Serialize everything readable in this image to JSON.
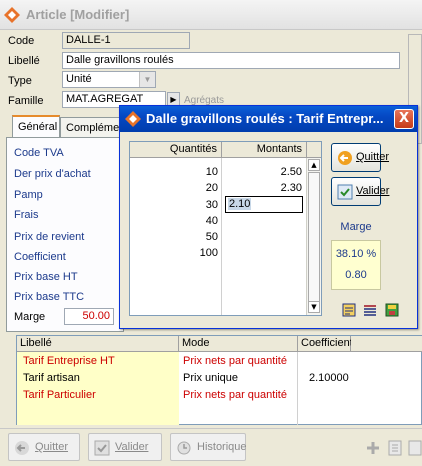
{
  "window": {
    "title": "Article [Modifier]"
  },
  "form": {
    "code_label": "Code",
    "code_value": "DALLE-1",
    "libelle_label": "Libellé",
    "libelle_value": "Dalle gravillons roulés",
    "type_label": "Type",
    "type_value": "Unité",
    "famille_label": "Famille",
    "famille_value": "MAT.AGREGAT",
    "famille_desc": "Agrégats"
  },
  "tabs": [
    {
      "label": "Général"
    },
    {
      "label": "Compléme"
    }
  ],
  "general_fields": [
    {
      "label": "Code TVA"
    },
    {
      "label": "Der prix d'achat"
    },
    {
      "label": "Pamp"
    },
    {
      "label": "Frais"
    },
    {
      "label": "Prix de revient"
    },
    {
      "label": "Coefficient"
    },
    {
      "label": "Prix base HT"
    },
    {
      "label": "Prix base TTC"
    },
    {
      "label": "Marge",
      "value": "50.00"
    }
  ],
  "tarif_table": {
    "headers": [
      "Libellé",
      "Mode",
      "Coefficient"
    ],
    "rows": [
      {
        "libelle": "Tarif Entreprise  HT",
        "mode": "Prix nets par quantité",
        "coefficient": ""
      },
      {
        "libelle": "Tarif artisan",
        "mode": "Prix unique",
        "coefficient": "2.10000"
      },
      {
        "libelle": "Tarif Particulier",
        "mode": "Prix nets par quantité",
        "coefficient": ""
      }
    ]
  },
  "bottom_buttons": {
    "quitter": "Quitter",
    "valider": "Valider",
    "historique": "Historique"
  },
  "dialog": {
    "title": "Dalle gravillons roulés : Tarif Entrepr...",
    "close": "X",
    "col_quantites": "Quantités",
    "col_montants": "Montants",
    "rows": [
      {
        "q": "10",
        "m": "2.50"
      },
      {
        "q": "20",
        "m": "2.30"
      },
      {
        "q": "30",
        "m": "2.10"
      },
      {
        "q": "40",
        "m": ""
      },
      {
        "q": "50",
        "m": ""
      },
      {
        "q": "100",
        "m": ""
      }
    ],
    "quitter_label": "Quitter",
    "valider_label": "Valider",
    "marge_label": "Marge",
    "marge_percent": "38.10 %",
    "marge_value": "0.80"
  },
  "colors": {
    "label_blue": "#1c3a8c",
    "red_text": "#cc0000",
    "dialog_title": "#0548c3"
  }
}
